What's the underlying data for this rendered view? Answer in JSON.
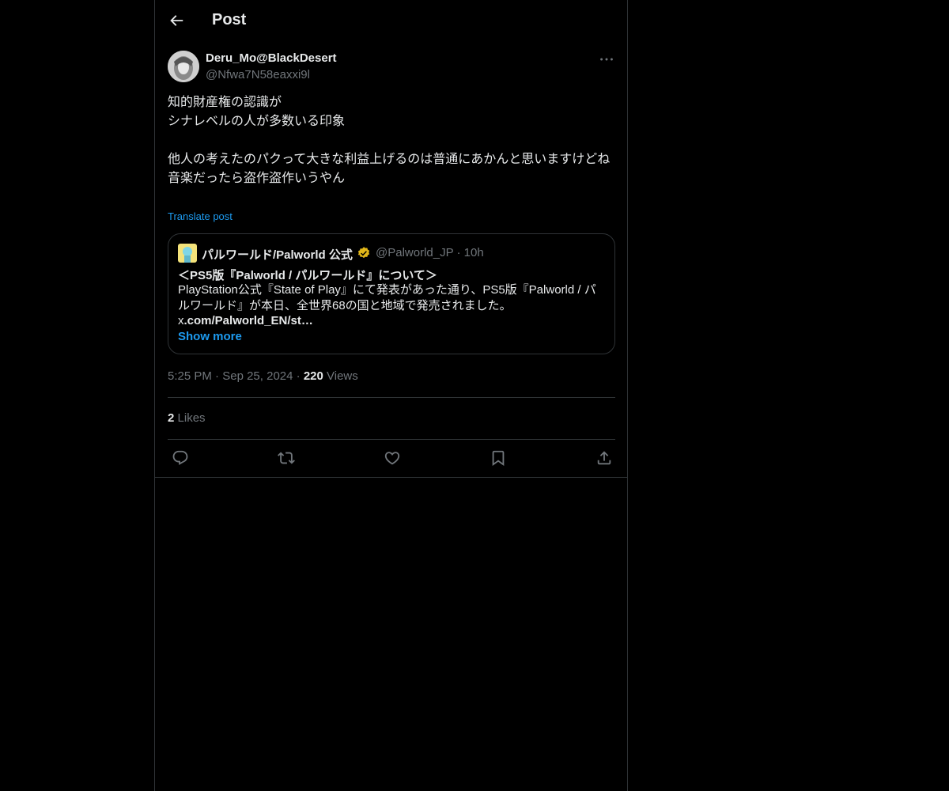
{
  "header": {
    "title": "Post"
  },
  "post": {
    "display_name": "Deru_Mo@BlackDesert",
    "handle": "@Nfwa7N58eaxxi9l",
    "text": "知的財産権の認識が\nシナレベルの人が多数いる印象\n\n他人の考えたのパクって大きな利益上げるのは普通にあかんと思いますけどね\n音楽だったら盗作盗作いうやん",
    "translate_label": "Translate post",
    "time": "5:25 PM",
    "date": "Sep 25, 2024",
    "views_count": "220",
    "views_label": "Views",
    "likes_count": "2",
    "likes_label": "Likes"
  },
  "quote": {
    "name": "パルワールド/Palworld 公式",
    "handle": "@Palworld_JP",
    "age": "10h",
    "title": "＜PS5版『Palworld / パルワールド』について＞",
    "text": "PlayStation公式『State of Play』にて発表があった通り、PS5版『Palworld / パルワールド』が本日、全世界68の国と地域で発売されました。",
    "link_prefix": "x",
    "link": ".com/Palworld_EN/st…",
    "show_more": "Show more"
  },
  "icons": {
    "back": "arrow-left-icon",
    "more": "more-horizontal-icon",
    "verified": "verified-badge-icon",
    "reply": "reply-icon",
    "repost": "repost-icon",
    "like": "heart-icon",
    "bookmark": "bookmark-icon",
    "share": "share-icon"
  },
  "colors": {
    "accent": "#1d9bf0",
    "muted": "#71767b",
    "verified": "#e2b719"
  }
}
